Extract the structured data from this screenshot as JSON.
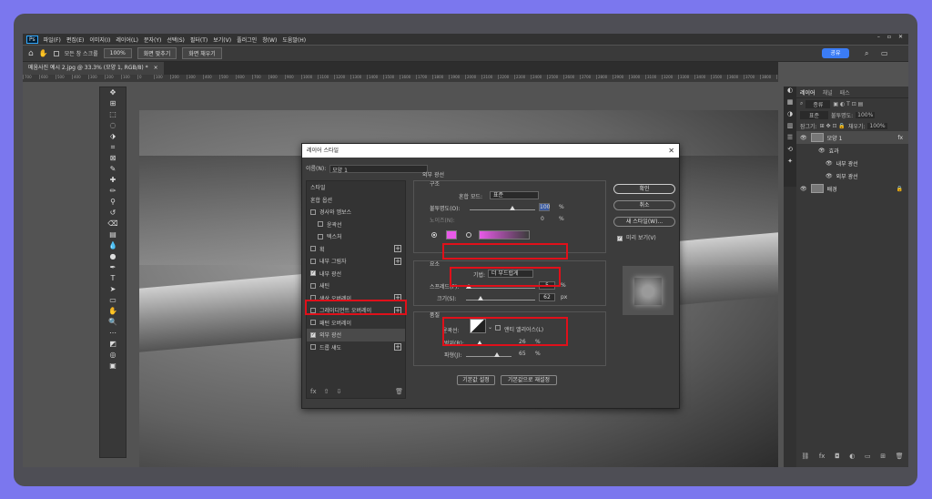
{
  "menubar": {
    "logo": "Ps",
    "items": [
      "파일(F)",
      "편집(E)",
      "이미지(I)",
      "레이어(L)",
      "문자(Y)",
      "선택(S)",
      "필터(T)",
      "보기(V)",
      "플러그인",
      "창(W)",
      "도움말(H)"
    ],
    "window_controls": [
      "–",
      "▫",
      "✕"
    ]
  },
  "options_bar": {
    "scroll_all_label": "모든 창 스크롤",
    "zoom_value": "100%",
    "fit_screen": "화면 맞추기",
    "fill_screen": "화면 채우기",
    "share": "공유"
  },
  "document_tab": {
    "title": "메움사진 예시 2.jpg @ 33.3% (모양 1, RGB/8) *",
    "close": "×"
  },
  "ruler": {
    "ticks": [
      "700",
      "600",
      "500",
      "400",
      "300",
      "200",
      "100",
      "0",
      "100",
      "200",
      "300",
      "400",
      "500",
      "600",
      "700",
      "800",
      "900",
      "1000",
      "1100",
      "1200",
      "1300",
      "1400",
      "1500",
      "1600",
      "1700",
      "1800",
      "1900",
      "2000",
      "2100",
      "2200",
      "2300",
      "2400",
      "2500",
      "2600",
      "2700",
      "2800",
      "2900",
      "3000",
      "3100",
      "3200",
      "3300",
      "3400",
      "3500",
      "3600",
      "3700",
      "3800",
      "3900",
      "4000",
      "4100",
      "4200",
      "4300",
      "4400",
      "4500"
    ]
  },
  "layers_panel": {
    "tabs": [
      "레이어",
      "채널",
      "패스"
    ],
    "search_kind": "종류",
    "blend_mode": "표준",
    "opacity_label": "불투명도:",
    "opacity_value": "100%",
    "lock_label": "잠그기:",
    "fill_label": "채우기:",
    "fill_value": "100%",
    "layers": [
      {
        "name": "모양 1",
        "badge": "fx"
      },
      {
        "name": "효과"
      },
      {
        "name": "내부 광선"
      },
      {
        "name": "외부 광선"
      },
      {
        "name": "배경"
      }
    ]
  },
  "dialog": {
    "title": "레이어 스타일",
    "close": "✕",
    "name_label": "이름(N):",
    "name_value": "모양 1",
    "list": {
      "header_styles": "스타일",
      "header_blend": "혼합 옵션",
      "items": [
        "경사와 엠보스",
        "윤곽선",
        "텍스처",
        "획",
        "내부 그림자",
        "내부 광선",
        "새틴",
        "색상 오버레이",
        "그레이디언트 오버레이",
        "패턴 오버레이",
        "외부 광선",
        "드롭 섀도"
      ]
    },
    "panel_title": "외부 광선",
    "structure": {
      "title": "구조",
      "blend_label": "혼합 모드:",
      "blend_value": "표준",
      "opacity_label": "불투명도(O):",
      "opacity_value": "100",
      "noise_label": "노이즈(N):",
      "noise_value": "0",
      "percent": "%"
    },
    "color": {
      "pink": "#e85ae8"
    },
    "elements": {
      "title": "요소",
      "method_label": "기법:",
      "method_value": "더 부드럽게",
      "spread_label": "스프레드(P):",
      "spread_value": "5",
      "size_label": "크기(S):",
      "size_value": "62",
      "percent": "%",
      "px": "px"
    },
    "quality": {
      "title": "품질",
      "contour_label": "윤곽선:",
      "antialias_label": "앤티 앨리어스(L)",
      "range_label": "범위(R):",
      "range_value": "26",
      "jitter_label": "파형(J):",
      "jitter_value": "65",
      "percent": "%"
    },
    "set_default": "기본값 설정",
    "reset_default": "기본값으로 재설정",
    "buttons": {
      "ok": "확인",
      "cancel": "취소",
      "new_style": "새 스타일(W)...",
      "preview": "미리 보기(V)"
    },
    "list_footer": [
      "fx",
      "⇧",
      "⇩",
      "🗑"
    ]
  },
  "highlight_color": "#e0101a"
}
